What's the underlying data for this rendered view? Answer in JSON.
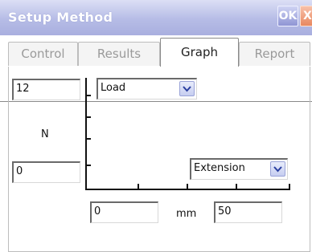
{
  "window": {
    "title": "Setup Method",
    "ok_label": "OK",
    "close_label": "X"
  },
  "tabs": [
    {
      "label": "Control",
      "active": false
    },
    {
      "label": "Results",
      "active": false
    },
    {
      "label": "Graph",
      "active": true
    },
    {
      "label": "Report",
      "active": false
    }
  ],
  "graph": {
    "y_axis": {
      "max_value": "12",
      "min_value": "0",
      "unit": "N",
      "quantity": "Load"
    },
    "x_axis": {
      "min_value": "0",
      "max_value": "50",
      "unit": "mm",
      "quantity": "Extension"
    }
  },
  "colors": {
    "titlebar": "#b6bce6",
    "dropdown_button": "#c6cdf0",
    "close_button": "#e88860"
  },
  "icons": {
    "dropdown": "chevron-down-icon"
  }
}
